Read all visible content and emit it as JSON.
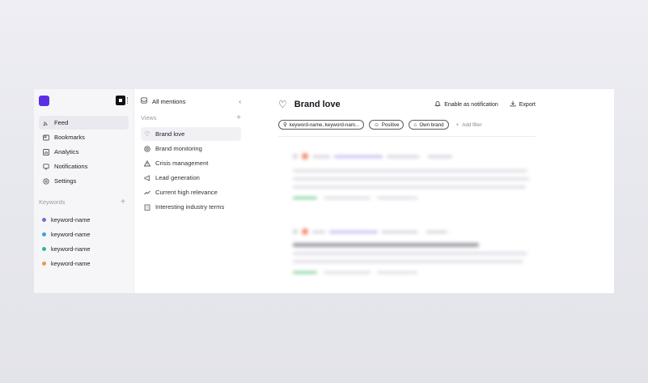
{
  "sidebar": {
    "items": [
      {
        "label": "Feed",
        "icon": "rss-icon",
        "active": true
      },
      {
        "label": "Bookmarks",
        "icon": "bookmark-icon",
        "active": false
      },
      {
        "label": "Analytics",
        "icon": "chart-icon",
        "active": false
      },
      {
        "label": "Notifications",
        "icon": "bell-icon",
        "active": false
      },
      {
        "label": "Settings",
        "icon": "gear-icon",
        "active": false
      }
    ],
    "keywords_title": "Keywords",
    "keywords": [
      {
        "label": "keyword-name",
        "color": "#6b6fd8"
      },
      {
        "label": "keyword-name",
        "color": "#3aa3d8"
      },
      {
        "label": "keyword-name",
        "color": "#2fb5a0"
      },
      {
        "label": "keyword-name",
        "color": "#f0964a"
      }
    ]
  },
  "views_panel": {
    "all_mentions": "All mentions",
    "views_title": "Views",
    "items": [
      {
        "label": "Brand love",
        "icon": "heart-icon",
        "active": true
      },
      {
        "label": "Brand monitoring",
        "icon": "target-icon",
        "active": false
      },
      {
        "label": "Crisis management",
        "icon": "warning-icon",
        "active": false
      },
      {
        "label": "Lead generation",
        "icon": "megaphone-icon",
        "active": false
      },
      {
        "label": "Current high relevance",
        "icon": "trend-icon",
        "active": false
      },
      {
        "label": "Interesting industry terms",
        "icon": "building-icon",
        "active": false
      }
    ]
  },
  "main": {
    "title": "Brand love",
    "enable_notification": "Enable as notification",
    "export": "Export",
    "filters": {
      "keywords_chip": "keyword-name, keyword-nam...",
      "sentiment_chip": "Positive",
      "brand_chip": "Own brand",
      "add_filter": "Add filter"
    }
  }
}
